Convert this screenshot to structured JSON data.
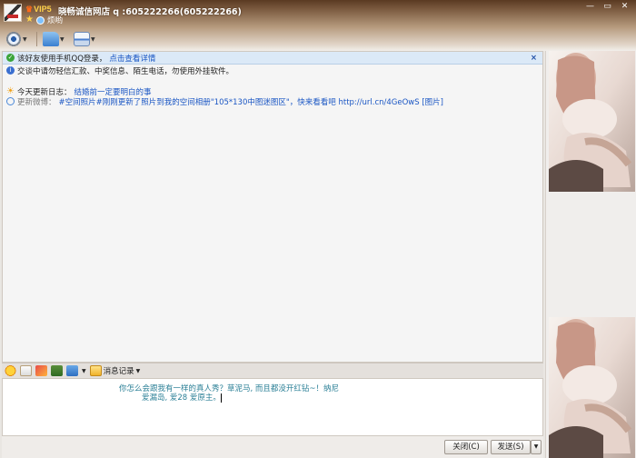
{
  "header": {
    "vip": "VIP5",
    "title": "晓畅诚信网店 q :605222266(605222266)",
    "status": "烦哟",
    "window_buttons": [
      "minimize",
      "maximize",
      "close"
    ]
  },
  "toolbar": {
    "tools": [
      "video-icon",
      "folder-icon",
      "app-icon"
    ]
  },
  "notice": {
    "text": "该好友使用手机QQ登录，",
    "link": "点击查看详情",
    "close": "×"
  },
  "safety": "交谈中请勿轻信汇款、中奖信息、陌生电话，勿使用外挂软件。",
  "update": {
    "label": "今天更新日志：",
    "link": "结婚前一定要明白的事"
  },
  "weibo": {
    "prefix": "更新微博：",
    "text": "#空间照片#刚刚更新了照片到我的空间相册\"105*130中图迷图区\"，快来看看吧 http://url.cn/4GeOwS [图片]"
  },
  "input_toolbar": {
    "history": "消息记录"
  },
  "input": {
    "line1": "你怎么会跟我有一样的真人秀？草泥马, 而且都没开红钻~！纳尼",
    "line2": "爱漏岛, 爱28  爱原主。"
  },
  "buttons": {
    "close": "关闭(C)",
    "send": "发送(S)",
    "send_dropdown": "▼"
  }
}
